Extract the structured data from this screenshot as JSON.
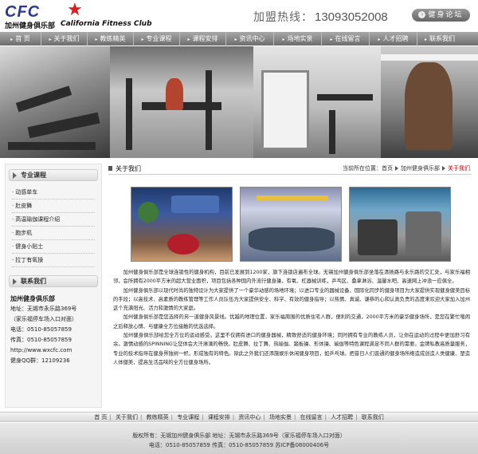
{
  "header": {
    "logo_mark": "CFC",
    "logo_cn": "加州健身俱乐部",
    "logo_en": "California Fitness Club",
    "hotline_label": "加盟热线：",
    "hotline_number": "13093052008",
    "forum_label": "健身论坛"
  },
  "nav": [
    {
      "label": "首 页"
    },
    {
      "label": "关于我们"
    },
    {
      "label": "教练精英"
    },
    {
      "label": "专业课程"
    },
    {
      "label": "课程安排"
    },
    {
      "label": "资讯中心"
    },
    {
      "label": "场地实景"
    },
    {
      "label": "在线留言"
    },
    {
      "label": "人才招聘"
    },
    {
      "label": "联系我们"
    }
  ],
  "sidebar": {
    "courses_title": "专业课程",
    "courses": [
      "动感单车",
      "肚皮舞",
      "高温瑜伽课程介绍",
      "跑步机",
      "健身小贴士",
      "拉丁有氧操"
    ],
    "contact_title": "联系我们",
    "contact": {
      "name": "加州健身俱乐部",
      "address": "地址：无锡市永乐路369号",
      "address2": "（家乐福停车场入口对面）",
      "phone": "电话：0510-85057859",
      "fax": "传真：0510-85057859",
      "website": "http://www.wxcfc.com",
      "qq": "健身QQ群：12109236"
    }
  },
  "main": {
    "title": "关于我们",
    "breadcrumb_prefix": "当前所在位置：",
    "breadcrumb": [
      "首页",
      "加州健身俱乐部",
      "关于我们"
    ],
    "paragraphs": [
      "加州健身俱乐部是全球连锁性的健身机构，目前已发展到1200家，旗下连锁店遍布全球。无锡加州健身俱乐部坐落在清扬路与永乐路的交汇处，与家乐福相邻，会所拥有2000平方米的超大营业面积，项目包括各种国内外流行健身操，有氧、杠器械训练，乒乓区、桑拿淋浴、温馨水吧、高速网上冲浪一应俱全。",
      "加州健身俱乐部以现代时尚的独特设计为大家提供了一个豪华动感的场地环境；以进口专业的器械设备、国际化同步的健身项目为大家提供实现健身健美目标的手段；以高技术、高素质的教练管理等工作人员队伍为大家提供安全、科学、有效的健身指导；以热情、真诚、谦恭的心和认真负责的态度来欢迎大家加入加州这个充满阳光、活力和激情的大家庭。",
      "加州健身俱乐部是您选择的另一道健身风景线。优越的地理位置，家乐福周围的优质住宅人群，便利的交通，2000平方米的豪华健身场所，是您在繁忙喧闹之后释放心情、与健康全方位接触的优选选择。",
      "加州健身俱乐部给您全方位的运动感受。这里不仅拥有进口的健身器械，精致舒适的健身环境；同时拥有专业的教练人员，让你在运动的过程中更加舒习有余。激情动感的SPINNING让您体会大汗淋漓的畅快。肚皮舞、拉丁舞、热瑜伽、踏板操、形体操、瑜伽等特色课程满足不同人群的需要。金牌私教高质量服务，专业的技术指导在健身界独树一帜，形成独有的特色。除此之外我们还添施娱乐休闲健身项目，如乒乓球。把昔日人们普通的健身场所络造成创造人类健康、塑造人体健美、提高生活品味的全方位健身场所。"
    ]
  },
  "footer": {
    "nav": [
      "首 页",
      "关于我们",
      "教练精英",
      "专业课程",
      "课程安排",
      "资讯中心",
      "场地实景",
      "在线留言",
      "人才招聘",
      "联系我们"
    ],
    "copyright": "版权所有：无锡加州健身俱乐部  地址：无锡市永乐路369号（家乐福停车场入口对面）",
    "contact_line": "电话：0510-85057859  传真：0510-85057859  苏ICP备08000406号"
  }
}
